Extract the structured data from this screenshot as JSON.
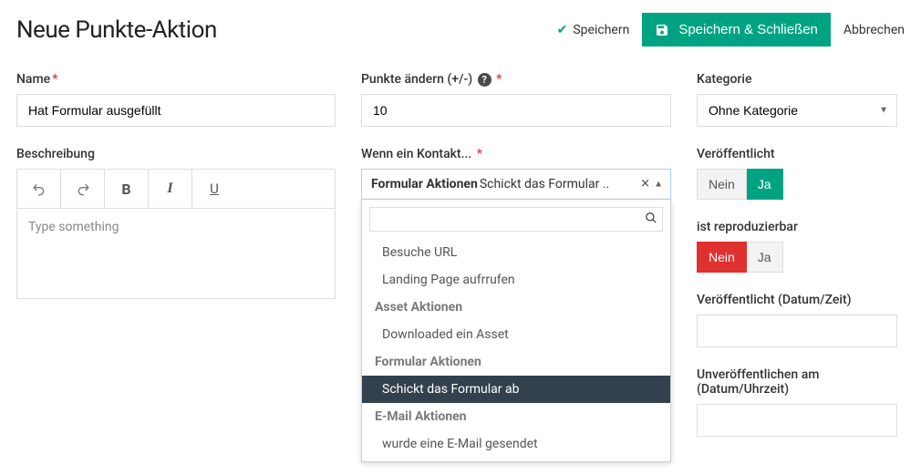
{
  "header": {
    "title": "Neue Punkte-Aktion",
    "save_label": "Speichern",
    "save_close_label": "Speichern & Schließen",
    "cancel_label": "Abbrechen"
  },
  "name": {
    "label": "Name",
    "value": "Hat Formular ausgefüllt"
  },
  "description": {
    "label": "Beschreibung",
    "placeholder": "Type something"
  },
  "points": {
    "label": "Punkte ändern (+/-)",
    "value": "10"
  },
  "contact_action": {
    "label": "Wenn ein Kontakt...",
    "selected_group": "Formular Aktionen",
    "selected_value_truncated": "Schickt das Formular ..",
    "groups": [
      {
        "items": [
          {
            "label": "Besuche URL",
            "selected": false
          },
          {
            "label": "Landing Page aufrrufen",
            "selected": false
          }
        ]
      },
      {
        "header": "Asset Aktionen",
        "items": [
          {
            "label": "Downloaded ein Asset",
            "selected": false
          }
        ]
      },
      {
        "header": "Formular Aktionen",
        "items": [
          {
            "label": "Schickt das Formular ab",
            "selected": true
          }
        ]
      },
      {
        "header": "E-Mail Aktionen",
        "items": [
          {
            "label": "wurde eine E-Mail gesendet",
            "selected": false
          }
        ]
      }
    ]
  },
  "category": {
    "label": "Kategorie",
    "value": "Ohne Kategorie"
  },
  "published": {
    "label": "Veröffentlicht",
    "no": "Nein",
    "yes": "Ja",
    "value": "Ja"
  },
  "repeatable": {
    "label": "ist reproduzierbar",
    "no": "Nein",
    "yes": "Ja",
    "value": "Nein"
  },
  "publish_up": {
    "label": "Veröffentlicht (Datum/Zeit)",
    "value": ""
  },
  "publish_down": {
    "label": "Unveröffentlichen am (Datum/Uhrzeit)",
    "value": ""
  }
}
